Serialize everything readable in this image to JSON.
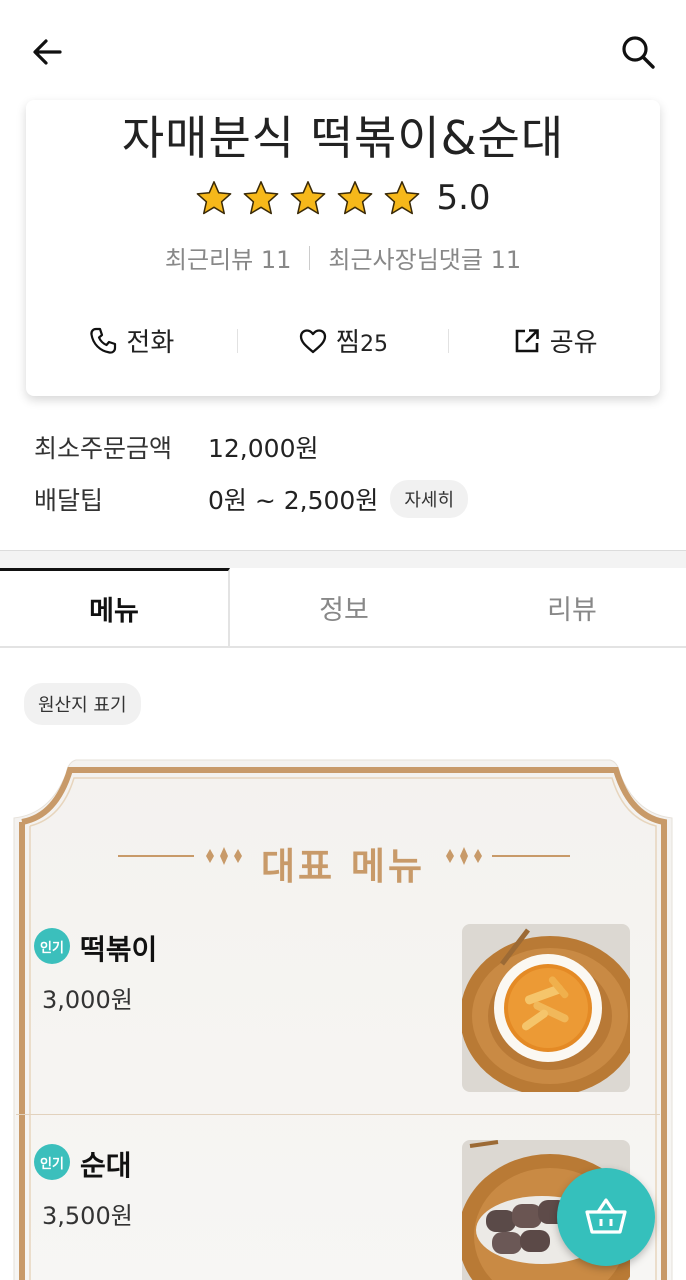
{
  "store": {
    "name": "자매분식 떡볶이&순대",
    "rating": 5.0,
    "rating_text": "5.0",
    "stars": 5,
    "recent_reviews": "최근리뷰 11",
    "owner_replies": "최근사장님댓글 11"
  },
  "actions": {
    "call": "전화",
    "favorite": "찜",
    "favorite_count": "25",
    "share": "공유"
  },
  "order_info": {
    "min_order_label": "최소주문금액",
    "min_order_value": "12,000원",
    "delivery_tip_label": "배달팁",
    "delivery_tip_value": "0원 ~ 2,500원",
    "detail_button": "자세히"
  },
  "tabs": [
    {
      "label": "메뉴",
      "active": true
    },
    {
      "label": "정보",
      "active": false
    },
    {
      "label": "리뷰",
      "active": false
    }
  ],
  "origin_label": "원산지 표기",
  "featured": {
    "title": "대표 메뉴",
    "items": [
      {
        "badge": "인기",
        "name": "떡볶이",
        "price": "3,000원"
      },
      {
        "badge": "인기",
        "name": "순대",
        "price": "3,500원"
      }
    ]
  },
  "icons": {
    "back": "arrow-left-icon",
    "search": "search-icon",
    "call": "phone-icon",
    "favorite": "heart-icon",
    "share": "share-icon",
    "cart": "basket-icon"
  },
  "colors": {
    "accent_teal": "#35c0bc",
    "board_gold": "#c89a69",
    "star_gold": "#f6b81a"
  }
}
